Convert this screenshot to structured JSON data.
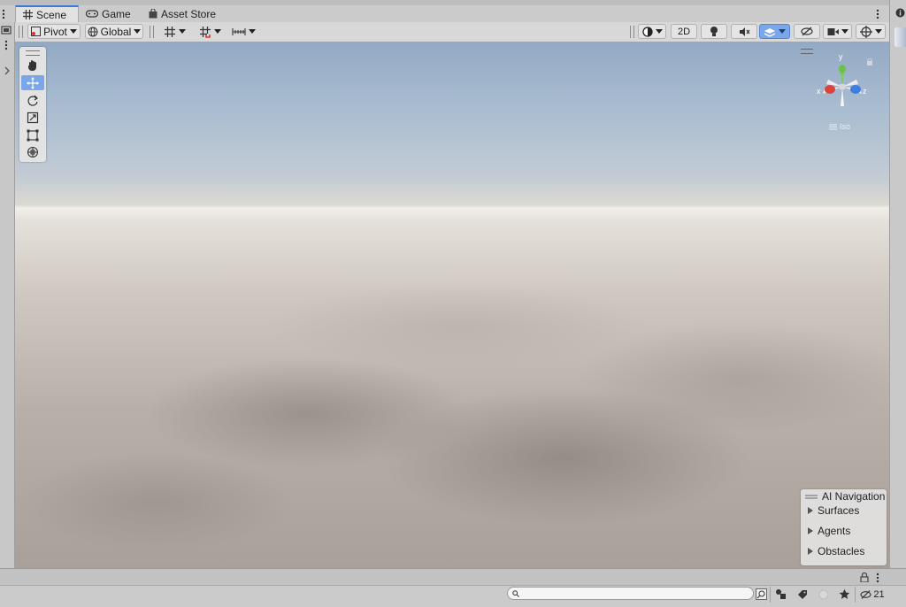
{
  "tabs": [
    {
      "label": "Scene",
      "icon": "grid-icon",
      "active": true
    },
    {
      "label": "Game",
      "icon": "gamepad-icon",
      "active": false
    },
    {
      "label": "Asset Store",
      "icon": "store-bag-icon",
      "active": false
    }
  ],
  "toolbar": {
    "pivot_label": "Pivot",
    "global_label": "Global",
    "mode_2d_label": "2D"
  },
  "tools": [
    "hand-tool",
    "move-tool",
    "rotate-tool",
    "scale-tool",
    "rect-tool",
    "transform-tool"
  ],
  "gizmo": {
    "y_label": "y",
    "x_label": "x",
    "z_label": "z",
    "projection_label": "Iso",
    "colors": {
      "x": "#d9443c",
      "y": "#6bc34a",
      "z": "#3d7ee0"
    }
  },
  "ai_navigation": {
    "title": "AI Navigation",
    "items": [
      "Surfaces",
      "Agents",
      "Obstacles"
    ]
  },
  "bottom": {
    "search_placeholder": "",
    "hidden_count": "21"
  }
}
